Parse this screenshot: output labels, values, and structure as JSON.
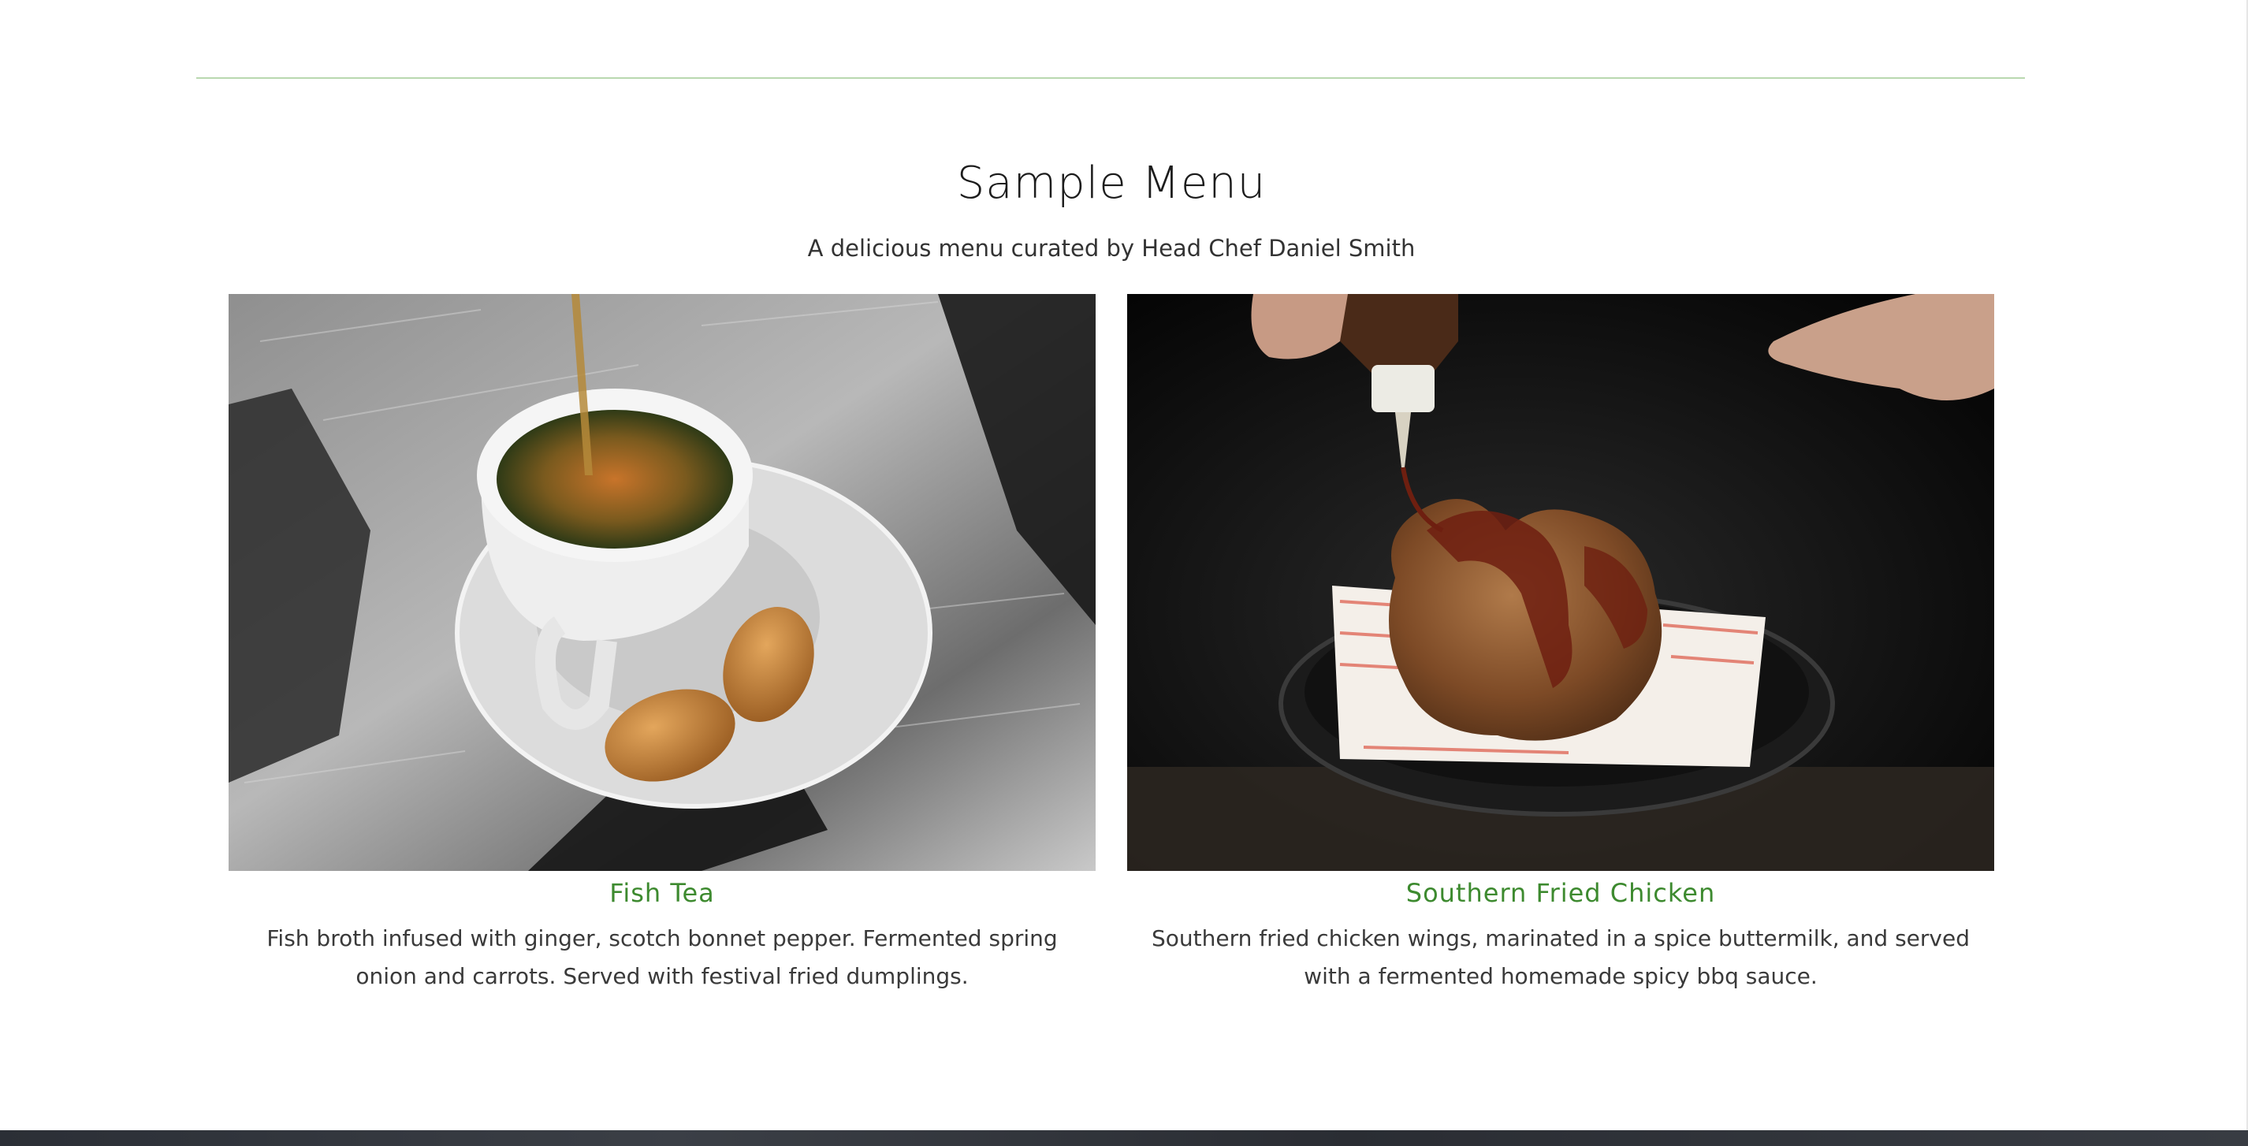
{
  "menu": {
    "title": "Sample Menu",
    "subtitle": "A delicious menu curated by Head Chef Daniel Smith"
  },
  "dishes": [
    {
      "name": "Fish Tea",
      "description": "Fish broth infused with ginger, scotch bonnet pepper. Fermented spring onion and carrots. Served with festival fried dumplings.",
      "photo_icon": "fish-tea-photo"
    },
    {
      "name": "Southern Fried Chicken",
      "description": "Southern fried chicken wings, marinated in a spice buttermilk, and served with a fermented homemade spicy bbq sauce.",
      "photo_icon": "fried-chicken-photo"
    }
  ],
  "colors": {
    "accent": "#3d8a2f",
    "divider": "#b9d8b0",
    "text": "#2b2b2b"
  }
}
